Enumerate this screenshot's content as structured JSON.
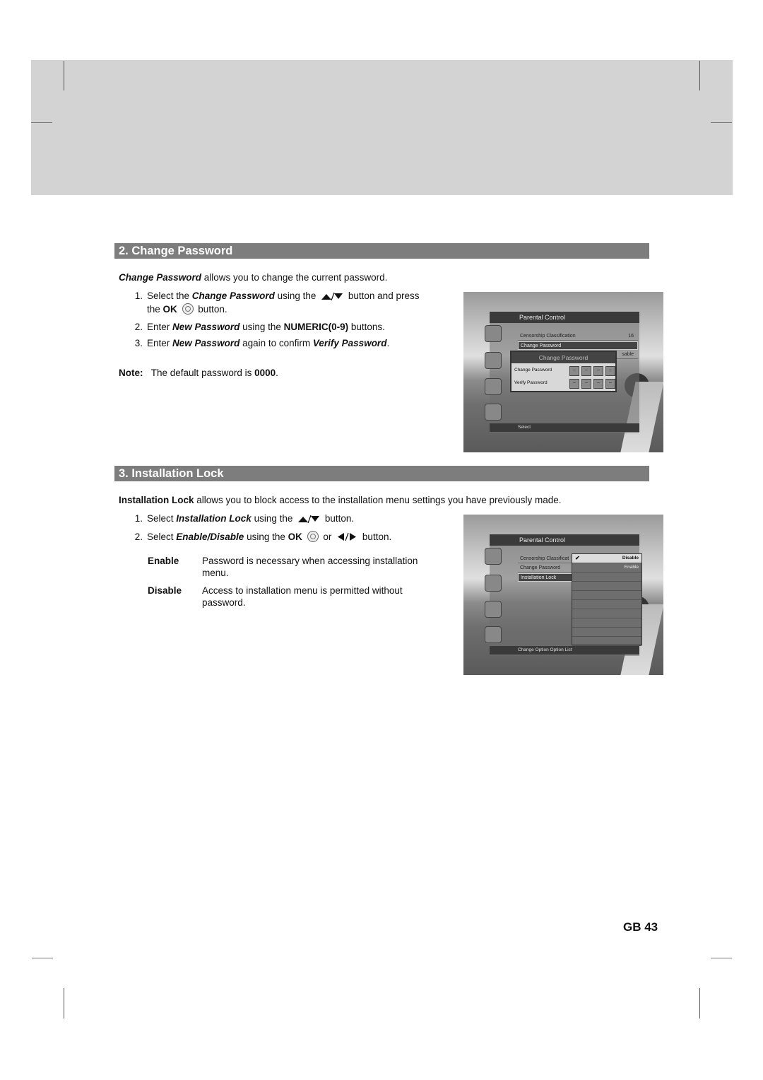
{
  "page": {
    "page_number": "GB 43"
  },
  "section2": {
    "heading": "2. Change Password",
    "intro_term": "Change Password",
    "intro_rest": " allows you to change the current password.",
    "steps": [
      {
        "num": "1.",
        "a": "Select the ",
        "b": "Change Password",
        "c": " using the",
        "d": " button and press",
        "line2_a": "the ",
        "line2_ok": "OK",
        "line2_b": " button."
      },
      {
        "num": "2.",
        "a": "Enter ",
        "b": "New Password",
        "c": " using the ",
        "d": "NUMERIC(0-9)",
        "e": " buttons."
      },
      {
        "num": "3.",
        "a": "Enter ",
        "b": "New Password",
        "c": " again to confirm ",
        "d": "Verify Password",
        "e": "."
      }
    ],
    "note_label": "Note:",
    "note_text": "The default password is ",
    "note_value": "0000",
    "note_end": ".",
    "screen": {
      "title": "Parental Control",
      "rows": [
        {
          "label": "Censorship Classification",
          "value": "16"
        },
        {
          "label": "Change Password",
          "value": ""
        },
        {
          "label": "",
          "value": "sable"
        }
      ],
      "popup_title": "Change Password",
      "popup_fields": [
        {
          "label": "Change Password",
          "digits": [
            "–",
            "–",
            "–",
            "–"
          ]
        },
        {
          "label": "Verify Password",
          "digits": [
            "–",
            "–",
            "–",
            "–"
          ]
        }
      ],
      "footer": "Select"
    }
  },
  "section3": {
    "heading": "3. Installation Lock",
    "intro_term": "Installation Lock",
    "intro_rest": " allows you to block access to the installation menu settings you have previously made.",
    "steps": [
      {
        "num": "1.",
        "a": "Select ",
        "b": "Installation Lock",
        "c": " using the",
        "d": " button."
      },
      {
        "num": "2.",
        "a": "Select ",
        "b": "Enable/Disable",
        "c": " using the ",
        "ok": "OK",
        "d": " or",
        "e": " button."
      }
    ],
    "definitions": [
      {
        "term": "Enable",
        "text": "Password is necessary when accessing installation menu."
      },
      {
        "term": "Disable",
        "text": "Access to installation menu is permitted without password."
      }
    ],
    "screen": {
      "title": "Parental Control",
      "rows": [
        {
          "label": "Censorship Classificat"
        },
        {
          "label": "Change Password"
        },
        {
          "label": "Installation Lock"
        }
      ],
      "options": [
        "Disable",
        "Enable"
      ],
      "selected_option": "Disable",
      "footer": "Change Option   Option List"
    }
  }
}
